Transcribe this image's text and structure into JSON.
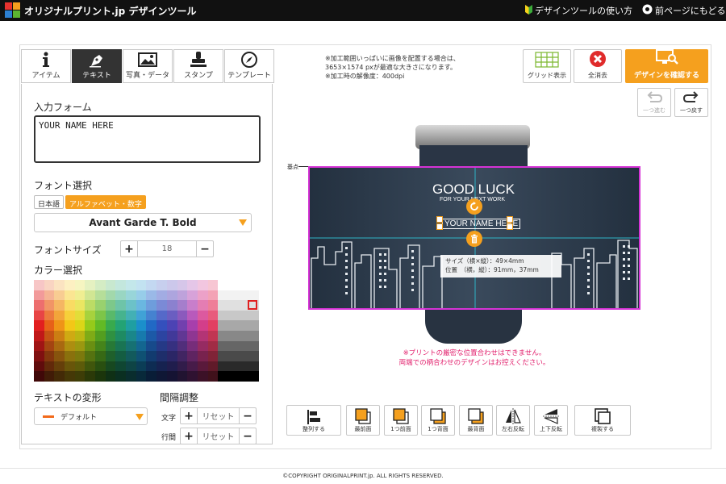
{
  "header": {
    "logo_text": "オリジナルプリント.jp デザインツール",
    "help_link": "デザインツールの使い方",
    "back_link": "前ページにもどる"
  },
  "tabs": [
    {
      "label": "アイテム",
      "icon": "info-icon"
    },
    {
      "label": "テキスト",
      "icon": "pen-icon",
      "active": true
    },
    {
      "label": "写真・データ",
      "icon": "image-icon"
    },
    {
      "label": "スタンプ",
      "icon": "stamp-icon"
    },
    {
      "label": "テンプレート",
      "icon": "compass-icon"
    }
  ],
  "text_panel": {
    "input_label": "入力フォーム",
    "input_value": "YOUR NAME HERE",
    "font_label": "フォント選択",
    "font_chip_jp": "日本語",
    "font_chip_alpha": "アルファベット・数字",
    "font_value": "Avant Garde T. Bold",
    "font_size_label": "フォントサイズ",
    "font_size_value": "18",
    "color_label": "カラー選択",
    "transform_label": "テキストの変形",
    "transform_value": "デフォルト",
    "spacing_label": "間隔調整",
    "char_label": "文字",
    "line_label": "行間",
    "reset_label": "リセット"
  },
  "palette_colors": [
    "#f7c6c6",
    "#f9d4c2",
    "#fbe3c1",
    "#fdf0c2",
    "#f6f5c1",
    "#e5f1c1",
    "#d4ecc4",
    "#c8e8cf",
    "#c3e7dd",
    "#c3e7ea",
    "#c2e2f1",
    "#c3d8f1",
    "#c7cfee",
    "#ccc8eb",
    "#d6c6e9",
    "#e5c6e8",
    "#f2c6e0",
    "#f7c6d3",
    "#ffffff",
    "#ffffff",
    "#ffffff",
    "#ffffff",
    "#f29a9a",
    "#f5b394",
    "#f8cc92",
    "#fbe592",
    "#f0ee92",
    "#d1e693",
    "#b6de99",
    "#a2d8ab",
    "#99d6c2",
    "#98d5d9",
    "#97cde9",
    "#9ab9e7",
    "#a2ace3",
    "#ada5de",
    "#bea2db",
    "#d7a2d9",
    "#eca1c8",
    "#f3a2b5",
    "#f2f2f2",
    "#f2f2f2",
    "#f2f2f2",
    "#f2f2f2",
    "#ed6e6e",
    "#f19466",
    "#f5b663",
    "#f9db63",
    "#eae662",
    "#bcdc65",
    "#99d16e",
    "#7dc88a",
    "#6ec4a8",
    "#6cc2c8",
    "#6ab7e0",
    "#6e9ddc",
    "#7b8ad6",
    "#8b81cf",
    "#a57ecc",
    "#c87ecb",
    "#e47db3",
    "#ee7e98",
    "#e0e0e0",
    "#e0e0e0",
    "#e0e0e0",
    "#e0e0e0",
    "#e84545",
    "#ec7a3d",
    "#f2a53a",
    "#f6d03a",
    "#e2dd39",
    "#a7d23d",
    "#7dc548",
    "#59b96a",
    "#46b38e",
    "#43b0b5",
    "#40a2d6",
    "#4582d0",
    "#5569c9",
    "#6a5ec1",
    "#8b5abd",
    "#b85abc",
    "#dc599f",
    "#e85b7c",
    "#c8c8c8",
    "#c8c8c8",
    "#c8c8c8",
    "#c8c8c8",
    "#e21f1f",
    "#e76118",
    "#ef9417",
    "#f3c717",
    "#dbd617",
    "#95ca1a",
    "#62ba25",
    "#38aa4d",
    "#23a375",
    "#1f9fa2",
    "#1b8fcb",
    "#2169c5",
    "#3450bd",
    "#4c43b4",
    "#7240ae",
    "#a73fac",
    "#d33e8a",
    "#e23f62",
    "#a8a8a8",
    "#a8a8a8",
    "#a8a8a8",
    "#a8a8a8",
    "#c11818",
    "#c55214",
    "#cb7e13",
    "#cfaa13",
    "#bab613",
    "#7fab16",
    "#539e1f",
    "#2f9141",
    "#1e8b63",
    "#1a878a",
    "#177aad",
    "#1c59a7",
    "#2c44a1",
    "#413999",
    "#613794",
    "#8e3692",
    "#b33475",
    "#c13553",
    "#888888",
    "#888888",
    "#888888",
    "#888888",
    "#a01414",
    "#a44411",
    "#a96910",
    "#ad8e10",
    "#9b9810",
    "#6a8f12",
    "#45841a",
    "#277936",
    "#197453",
    "#167173",
    "#136690",
    "#174a8b",
    "#253986",
    "#363080",
    "#512e7b",
    "#772d7a",
    "#962b62",
    "#a12c45",
    "#666666",
    "#666666",
    "#666666",
    "#666666",
    "#801010",
    "#83360d",
    "#87540d",
    "#8a710d",
    "#7c790d",
    "#557210",
    "#376915",
    "#1f602b",
    "#145d42",
    "#125a5c",
    "#0f5173",
    "#123b6f",
    "#1e2e6b",
    "#2b2666",
    "#412562",
    "#5f2461",
    "#78224e",
    "#802337",
    "#4a4a4a",
    "#4a4a4a",
    "#4a4a4a",
    "#4a4a4a",
    "#600c0c",
    "#62290a",
    "#653f0a",
    "#68550a",
    "#5d5b0a",
    "#40560c",
    "#294f10",
    "#174820",
    "#0f4632",
    "#0e4445",
    "#0b3d56",
    "#0e2c53",
    "#162250",
    "#201d4d",
    "#311c4a",
    "#471b49",
    "#5a193b",
    "#601a29",
    "#2a2a2a",
    "#2a2a2a",
    "#2a2a2a",
    "#2a2a2a",
    "#400808",
    "#411b07",
    "#432a07",
    "#453807",
    "#3e3d07",
    "#2b3908",
    "#1b350b",
    "#0f3015",
    "#0a2f21",
    "#092d2e",
    "#08293a",
    "#091d37",
    "#0f1735",
    "#151333",
    "#211331",
    "#2f1231",
    "#3c1127",
    "#40111b",
    "#000000",
    "#000000",
    "#000000",
    "#000000"
  ],
  "note": {
    "line1": "※加工範囲いっぱいに画像を配置する場合は、",
    "line2": "3653×1574 pxが最適な大きさになります。",
    "line3": "※加工時の解像度：400dpi"
  },
  "top_buttons": {
    "grid": "グリッド表示",
    "clear": "全消去",
    "confirm": "デザインを確認する",
    "redo": "一つ進む",
    "undo": "一つ戻す"
  },
  "canvas": {
    "kijun": "基点",
    "design_title": "GOOD LUCK",
    "design_subtitle": "FOR YOUR NEXT WORK",
    "design_name": "YOUR NAME HERE",
    "tooltip_size": "サイズ（横×縦）：49×4mm",
    "tooltip_pos": "位置　（横，縦）：91mm，37mm",
    "warning_line1": "※プリントの厳密な位置合わせはできません。",
    "warning_line2": "両端での柄合わせのデザインはお控えください。"
  },
  "bottom_toolbar": [
    {
      "label": "整列する",
      "icon": "align-icon"
    },
    {
      "label": "最前面",
      "icon": "bring-front-icon"
    },
    {
      "label": "1つ前面",
      "icon": "bring-forward-icon"
    },
    {
      "label": "1つ背面",
      "icon": "send-backward-icon"
    },
    {
      "label": "最背面",
      "icon": "send-back-icon"
    },
    {
      "label": "左右反転",
      "icon": "flip-horizontal-icon"
    },
    {
      "label": "上下反転",
      "icon": "flip-vertical-icon"
    },
    {
      "label": "複製する",
      "icon": "duplicate-icon"
    }
  ],
  "footer": "©COPYRIGHT ORIGINALPRINT.jp. ALL RIGHTS RESERVED.",
  "colors": {
    "accent": "#f5a01e",
    "header_bg": "#111111",
    "selection": "#d633d6",
    "warning": "#e2206d"
  }
}
